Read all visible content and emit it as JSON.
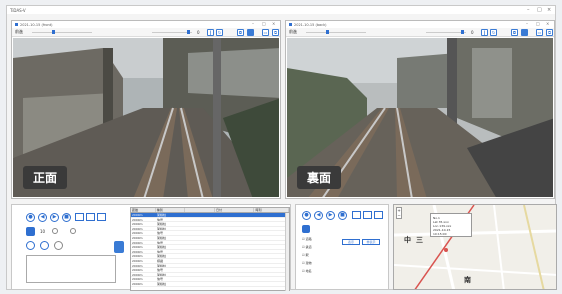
{
  "window": {
    "title": "TiDAS-V"
  },
  "left_pane": {
    "title": "2021-10-15 (front)",
    "toolbar_label": "前進",
    "speed": "0",
    "label": "正面"
  },
  "right_pane": {
    "title": "2021-10-15 (back)",
    "toolbar_label": "前進",
    "speed": "0",
    "label": "裏面"
  },
  "controls": {
    "count": "10"
  },
  "table": {
    "headers": [
      "距離",
      "種別",
      "",
      "日付",
      "時刻"
    ],
    "rows": [
      [
        "2000m",
        "架線柱",
        "",
        "",
        ""
      ],
      [
        "2000m",
        "信号",
        "",
        "",
        ""
      ],
      [
        "2000m",
        "架線柱",
        "",
        "",
        ""
      ],
      [
        "2000m",
        "架線柱",
        "",
        "",
        ""
      ],
      [
        "2000m",
        "信号",
        "",
        "",
        ""
      ],
      [
        "2000m",
        "架線柱",
        "",
        "",
        ""
      ],
      [
        "2000m",
        "信号",
        "",
        "",
        ""
      ],
      [
        "2000m",
        "架線柱",
        "",
        "",
        ""
      ],
      [
        "2000m",
        "信号",
        "",
        "",
        ""
      ],
      [
        "2000m",
        "架線柱",
        "",
        "",
        ""
      ],
      [
        "2000m",
        "標識",
        "",
        "",
        ""
      ],
      [
        "2000m",
        "架線柱",
        "",
        "",
        ""
      ],
      [
        "2000m",
        "信号",
        "",
        "",
        ""
      ],
      [
        "2000m",
        "架線柱",
        "",
        "",
        ""
      ],
      [
        "2000m",
        "信号",
        "",
        "",
        ""
      ],
      [
        "2000m",
        "架線柱",
        "",
        "",
        ""
      ]
    ]
  },
  "layers": {
    "items": [
      "道路",
      "鉄道",
      "駅",
      "建物",
      "地名"
    ],
    "btn1": "表示",
    "btn2": "非表示"
  },
  "map": {
    "popup_lines": [
      "No.1",
      "Lat 35.xxx",
      "Lon 139.xxx",
      "2021-10-15",
      "10:15:00"
    ],
    "chars": [
      "中",
      "三",
      "南"
    ]
  }
}
